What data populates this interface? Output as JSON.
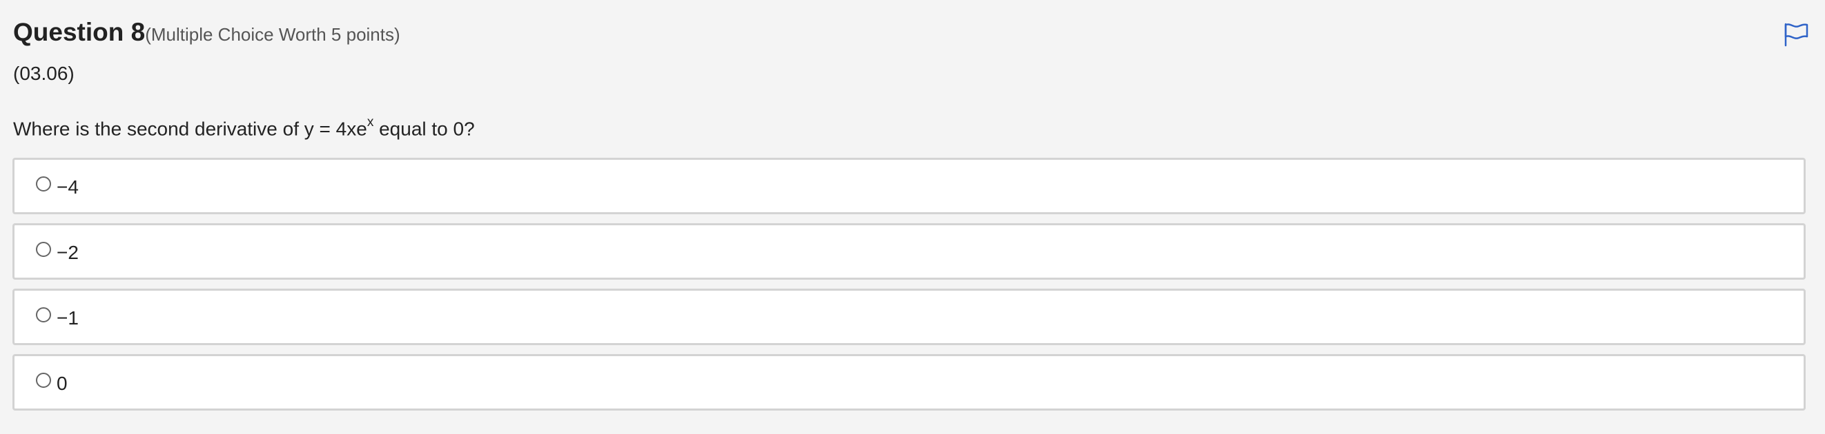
{
  "question": {
    "title": "Question 8",
    "worth": "(Multiple Choice Worth 5 points)",
    "code": "(03.06)",
    "text_before": "Where is the second derivative of y = 4xe",
    "text_sup": "x",
    "text_after": " equal to 0?"
  },
  "flag": {
    "icon": "flag-icon",
    "color": "#2f63c8"
  },
  "choices": [
    {
      "label": "−4",
      "selected": false
    },
    {
      "label": "−2",
      "selected": false
    },
    {
      "label": "−1",
      "selected": false
    },
    {
      "label": "0",
      "selected": false
    }
  ]
}
